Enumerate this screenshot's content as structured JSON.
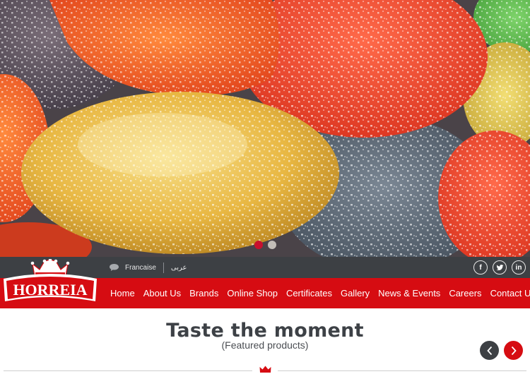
{
  "hero": {
    "image_name": "sugar-coated-jelly-candies",
    "slides_count": 2,
    "active_slide": 1
  },
  "topbar": {
    "lang_french": "Francaise",
    "lang_arabic": "عربى",
    "social": [
      {
        "name": "facebook-icon",
        "glyph": "f"
      },
      {
        "name": "twitter-icon",
        "glyph": "t"
      },
      {
        "name": "linkedin-icon",
        "glyph": "in"
      }
    ]
  },
  "brand": {
    "name": "HORREIA",
    "color": "#d60c12",
    "dark": "#3d4044"
  },
  "nav": {
    "items": [
      "Home",
      "About Us",
      "Brands",
      "Online Shop",
      "Certificates",
      "Gallery",
      "News & Events",
      "Careers",
      "Contact Us"
    ]
  },
  "featured": {
    "title": "Taste the moment",
    "subtitle": "(Featured products)"
  }
}
